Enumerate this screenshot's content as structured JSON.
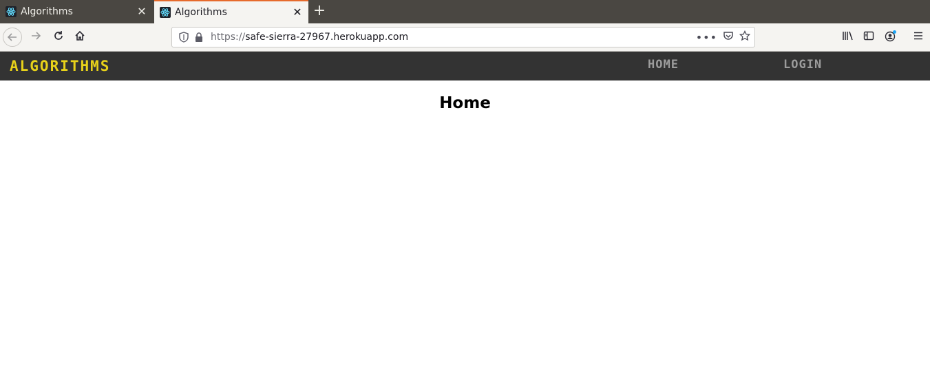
{
  "browser": {
    "tabs": [
      {
        "title": "Algorithms",
        "active": false
      },
      {
        "title": "Algorithms",
        "active": true
      }
    ],
    "address": {
      "scheme": "https://",
      "host": "safe-sierra-27967.herokuapp.com"
    },
    "accent_color": "#e66a2c"
  },
  "site": {
    "brand": "ALGORITHMS",
    "brand_color": "#e8d21a",
    "navbar_color": "#333333",
    "nav": {
      "home": "HOME",
      "login": "LOGIN"
    }
  },
  "main": {
    "heading": "Home"
  }
}
